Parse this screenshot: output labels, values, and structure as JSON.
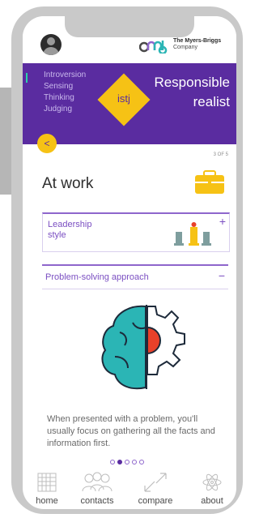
{
  "header": {
    "logo_line1": "The Myers-Briggs",
    "logo_line2": "Company"
  },
  "profile": {
    "traits": [
      "Introversion",
      "Sensing",
      "Thinking",
      "Judging"
    ],
    "type_code": "istj",
    "title_line1": "Responsible",
    "title_line2": "realist"
  },
  "pager": "3 OF 5",
  "section": {
    "title": "At work"
  },
  "cards": [
    {
      "label_line1": "Leadership",
      "label_line2": "style",
      "toggle": "+"
    },
    {
      "label": "Problem-solving approach",
      "toggle": "−"
    }
  ],
  "description": "When presented with a problem, you'll usually focus on gathering all the facts and information first.",
  "carousel": {
    "count": 5,
    "active_index": 1
  },
  "nav": [
    {
      "label": "home",
      "icon": "home-icon"
    },
    {
      "label": "contacts",
      "icon": "contacts-icon"
    },
    {
      "label": "compare",
      "icon": "compare-icon"
    },
    {
      "label": "about",
      "icon": "about-icon"
    }
  ],
  "colors": {
    "purple": "#5a2ca0",
    "yellow": "#f6c215",
    "teal": "#2bb5b5",
    "red": "#e8412a"
  }
}
